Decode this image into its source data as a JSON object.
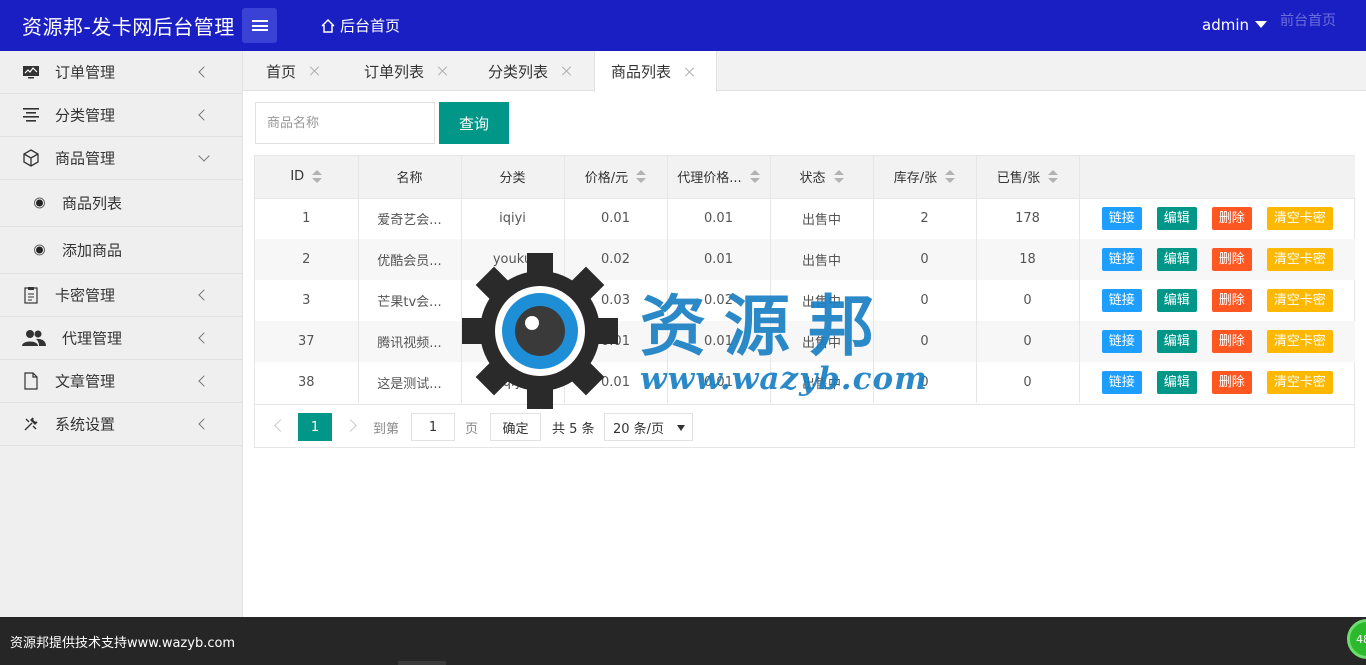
{
  "header": {
    "logo": "资源邦-发卡网后台管理",
    "menu_toggle_icon": "menu-icon",
    "home_link": "后台首页",
    "user": "admin",
    "front_link": "前台首页",
    "color": "#1a1fc4"
  },
  "sidebar": {
    "items": [
      {
        "label": "订单管理",
        "icon": "monitor-chart-icon"
      },
      {
        "label": "分类管理",
        "icon": "align-list-icon"
      },
      {
        "label": "商品管理",
        "icon": "cube-icon",
        "expanded": true,
        "children": [
          {
            "label": "商品列表"
          },
          {
            "label": "添加商品"
          }
        ]
      },
      {
        "label": "卡密管理",
        "icon": "clipboard-icon"
      },
      {
        "label": "代理管理",
        "icon": "users-icon"
      },
      {
        "label": "文章管理",
        "icon": "file-icon"
      },
      {
        "label": "系统设置",
        "icon": "tools-icon"
      }
    ]
  },
  "tabs": [
    {
      "label": "首页"
    },
    {
      "label": "订单列表"
    },
    {
      "label": "分类列表"
    },
    {
      "label": "商品列表",
      "active": true
    }
  ],
  "search": {
    "placeholder": "商品名称",
    "button": "查询"
  },
  "table": {
    "columns": [
      "ID",
      "名称",
      "分类",
      "价格/元",
      "代理价格...",
      "状态",
      "库存/张",
      "已售/张"
    ],
    "rows": [
      {
        "id": "1",
        "name": "爱奇艺会...",
        "category": "iqiyi",
        "price": "0.01",
        "agent_price": "0.01",
        "status": "出售中",
        "stock": "2",
        "sold": "178"
      },
      {
        "id": "2",
        "name": "优酷会员...",
        "category": "youku",
        "price": "0.02",
        "agent_price": "0.01",
        "status": "出售中",
        "stock": "0",
        "sold": "18"
      },
      {
        "id": "3",
        "name": "芒果tv会...",
        "category": "mgtv",
        "price": "0.03",
        "agent_price": "0.02",
        "status": "出售中",
        "stock": "0",
        "sold": "0"
      },
      {
        "id": "37",
        "name": "腾讯视频...",
        "category": "iqiyi",
        "price": "0.01",
        "agent_price": "0.01",
        "status": "出售中",
        "stock": "0",
        "sold": "0"
      },
      {
        "id": "38",
        "name": "这是测试...",
        "category": "iqiyi",
        "price": "0.01",
        "agent_price": "0.01",
        "status": "出售中",
        "stock": "0",
        "sold": "0"
      }
    ],
    "actions": {
      "link": "链接",
      "edit": "编辑",
      "delete": "删除",
      "clear": "清空卡密"
    }
  },
  "pager": {
    "current": "1",
    "goto_label": "到第",
    "page_input": "1",
    "page_unit": "页",
    "confirm": "确定",
    "total": "共 5 条",
    "page_size": "20 条/页"
  },
  "watermark": {
    "title": "资源邦",
    "url": "www.wazyb.com"
  },
  "footer": {
    "text": "资源邦提供技术支持www.wazyb.com",
    "badge": "48"
  }
}
